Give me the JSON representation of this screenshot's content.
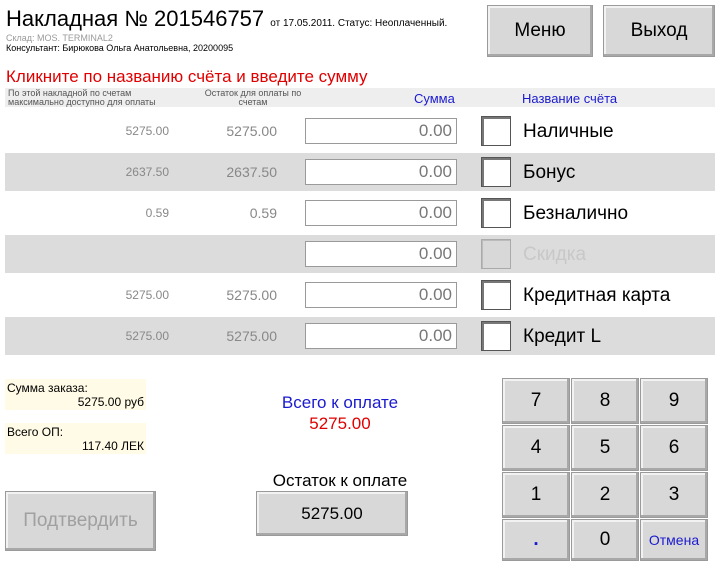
{
  "header": {
    "title": "Накладная № 201546757",
    "title_suffix": "от 17.05.2011. Статус: Неоплаченный.",
    "warehouse": "Склад: MOS. TERMINAL2",
    "consultant": "Консультант: Бирюкова Ольга Анатольевна, 20200095"
  },
  "top_buttons": {
    "menu": "Меню",
    "exit": "Выход"
  },
  "instruction": "Кликните по названию счёта и введите сумму",
  "columns": {
    "col1": "По этой накладной по счетам максимально доступно для оплаты",
    "col2": "Остаток для оплаты по счетам",
    "sum": "Сумма",
    "account": "Название счёта"
  },
  "rows": [
    {
      "max": "5275.00",
      "remaining": "5275.00",
      "sum": "0.00",
      "name": "Наличные",
      "enabled": true
    },
    {
      "max": "2637.50",
      "remaining": "2637.50",
      "sum": "0.00",
      "name": "Бонус",
      "enabled": true
    },
    {
      "max": "0.59",
      "remaining": "0.59",
      "sum": "0.00",
      "name": "Безналично",
      "enabled": true
    },
    {
      "max": "",
      "remaining": "",
      "sum": "0.00",
      "name": "Скидка",
      "enabled": false
    },
    {
      "max": "5275.00",
      "remaining": "5275.00",
      "sum": "0.00",
      "name": "Кредитная карта",
      "enabled": true
    },
    {
      "max": "5275.00",
      "remaining": "5275.00",
      "sum": "0.00",
      "name": "Кредит L",
      "enabled": true
    }
  ],
  "summary": {
    "order_label": "Сумма заказа:",
    "order_value": "5275.00 руб",
    "op_label": "Всего ОП:",
    "op_value": "117.40 ЛЕК"
  },
  "totals": {
    "total_label": "Всего к оплате",
    "total_value": "5275.00",
    "remaining_label": "Остаток к оплате",
    "remaining_value": "5275.00"
  },
  "confirm_label": "Подтвердить",
  "keypad": {
    "k7": "7",
    "k8": "8",
    "k9": "9",
    "k4": "4",
    "k5": "5",
    "k6": "6",
    "k1": "1",
    "k2": "2",
    "k3": "3",
    "kdot": ".",
    "k0": "0",
    "cancel": "Отмена"
  },
  "colors": {
    "instruction": "#e00000",
    "header_blue": "#1a1ad0",
    "total_value": "#e00000"
  }
}
